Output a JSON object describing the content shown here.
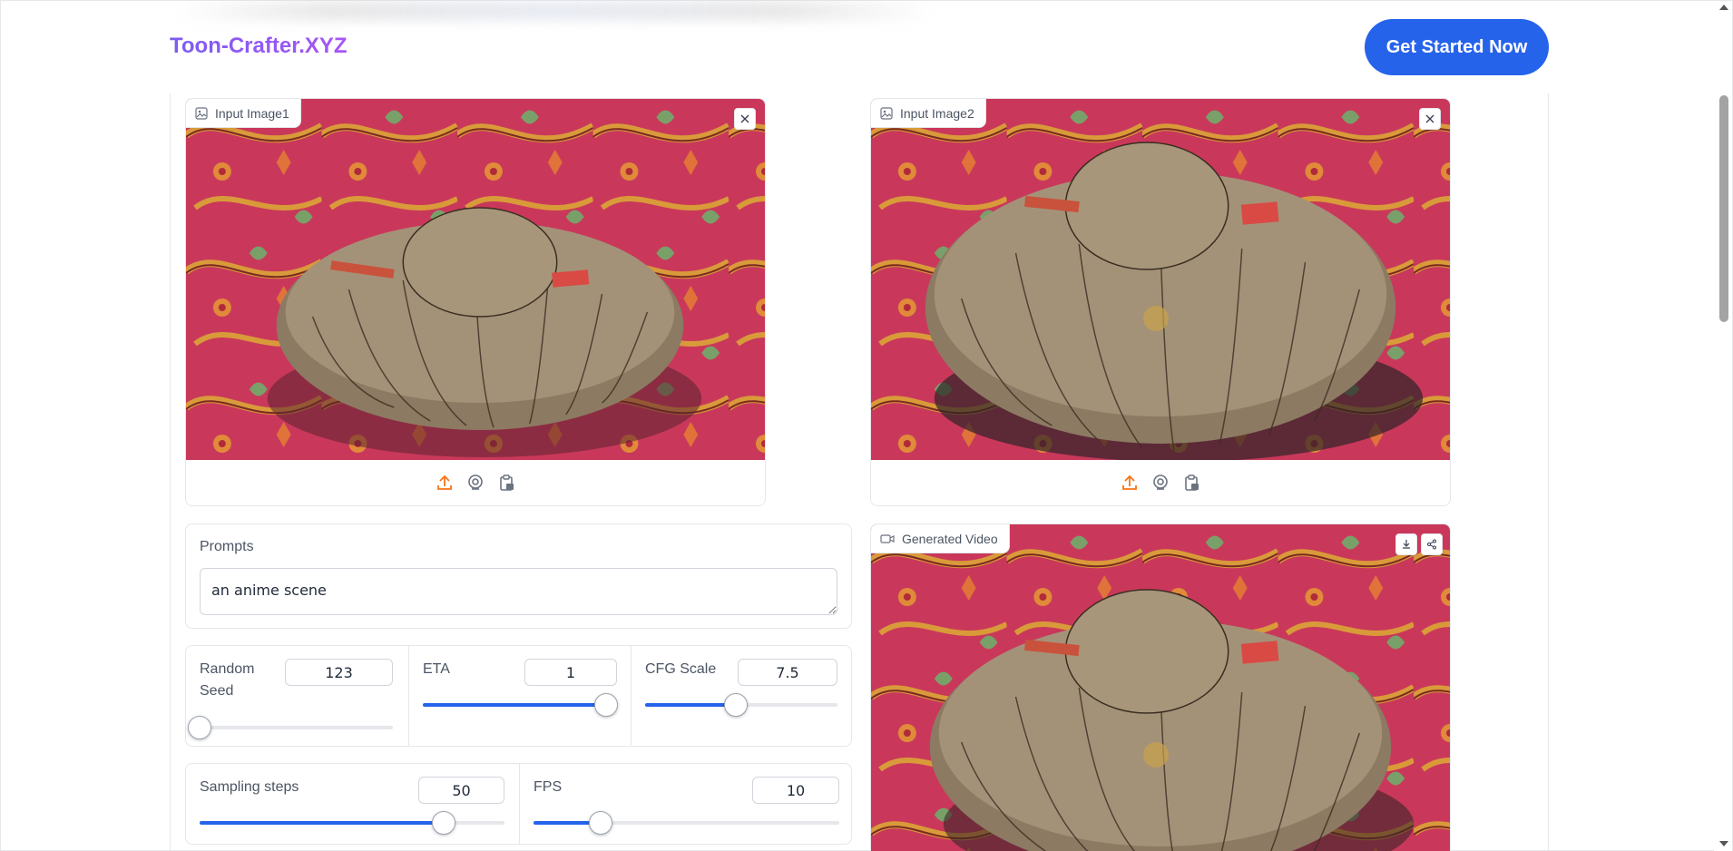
{
  "header": {
    "brand": "Toon-Crafter.XYZ",
    "cta_label": "Get Started Now"
  },
  "input1": {
    "label": "Input Image1"
  },
  "input2": {
    "label": "Input Image2"
  },
  "prompts": {
    "label": "Prompts",
    "value": "an anime scene"
  },
  "params_row1": {
    "seed": {
      "label": "Random Seed",
      "value": "123",
      "fraction": 0.0
    },
    "eta": {
      "label": "ETA",
      "value": "1",
      "fraction": 1.0
    },
    "cfg": {
      "label": "CFG Scale",
      "value": "7.5",
      "fraction": 0.47
    }
  },
  "params_row2": {
    "steps": {
      "label": "Sampling steps",
      "value": "50",
      "fraction": 0.8
    },
    "fps": {
      "label": "FPS",
      "value": "10",
      "fraction": 0.22
    }
  },
  "video": {
    "label": "Generated Video"
  },
  "colors": {
    "accent": "#2563eb",
    "brand_start": "#7c5cf0",
    "brand_end": "#a855f7",
    "upload_icon": "#f97316"
  },
  "icons": [
    "image-icon",
    "close-icon",
    "upload-icon",
    "webcam-icon",
    "clipboard-icon",
    "video-icon",
    "download-icon",
    "share-icon"
  ]
}
